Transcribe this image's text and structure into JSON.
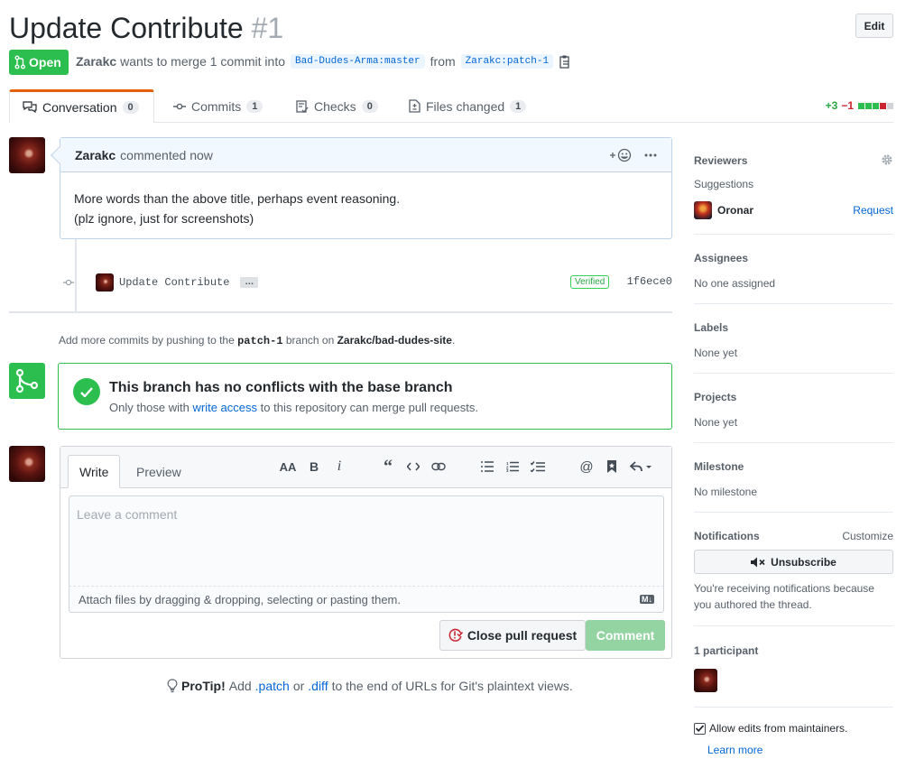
{
  "header": {
    "title": "Update Contribute",
    "number": "#1",
    "edit_label": "Edit",
    "state": "Open",
    "author": "Zarakc",
    "merge_text": "wants to merge 1 commit into",
    "base_branch": "Bad-Dudes-Arma:master",
    "from_text": "from",
    "head_branch": "Zarakc:patch-1"
  },
  "tabs": [
    {
      "label": "Conversation",
      "count": "0"
    },
    {
      "label": "Commits",
      "count": "1"
    },
    {
      "label": "Checks",
      "count": "0"
    },
    {
      "label": "Files changed",
      "count": "1"
    }
  ],
  "diffstat": {
    "additions": "+3",
    "deletions": "−1"
  },
  "comment": {
    "author": "Zarakc",
    "meta": "commented now",
    "body_line1": "More words than the above title, perhaps event reasoning.",
    "body_line2": "(plz ignore, just for screenshots)"
  },
  "commit": {
    "message": "Update Contribute",
    "verified": "Verified",
    "sha": "1f6ece0"
  },
  "add_commits": {
    "prefix": "Add more commits by pushing to the",
    "branch": "patch-1",
    "middle": "branch on",
    "repo": "Zarakc/bad-dudes-site",
    "suffix": "."
  },
  "merge": {
    "heading": "This branch has no conflicts with the base branch",
    "sub_prefix": "Only those with",
    "sub_link": "write access",
    "sub_suffix": "to this repository can merge pull requests."
  },
  "composer": {
    "write_tab": "Write",
    "preview_tab": "Preview",
    "placeholder": "Leave a comment",
    "attach_text": "Attach files by dragging & dropping, selecting or pasting them.",
    "close_label": "Close pull request",
    "comment_label": "Comment",
    "md_badge": "M↓"
  },
  "protip": {
    "label": "ProTip!",
    "text1": "Add",
    "link1": ".patch",
    "text2": "or",
    "link2": ".diff",
    "text3": "to the end of URLs for Git's plaintext views."
  },
  "sidebar": {
    "reviewers": {
      "heading": "Reviewers",
      "suggestions": "Suggestions",
      "suggested_user": "Oronar",
      "request_label": "Request"
    },
    "assignees": {
      "heading": "Assignees",
      "value": "No one assigned"
    },
    "labels": {
      "heading": "Labels",
      "value": "None yet"
    },
    "projects": {
      "heading": "Projects",
      "value": "None yet"
    },
    "milestone": {
      "heading": "Milestone",
      "value": "No milestone"
    },
    "notifications": {
      "heading": "Notifications",
      "customize": "Customize",
      "unsubscribe": "Unsubscribe",
      "reason": "You're receiving notifications because you authored the thread."
    },
    "participants": {
      "heading": "1 participant"
    },
    "maintainers": {
      "label": "Allow edits from maintainers.",
      "learn_more": "Learn more",
      "checked": true
    }
  },
  "colors": {
    "open_green": "#2cbe4e",
    "link_blue": "#0366d6",
    "tab_accent": "#e36209"
  }
}
